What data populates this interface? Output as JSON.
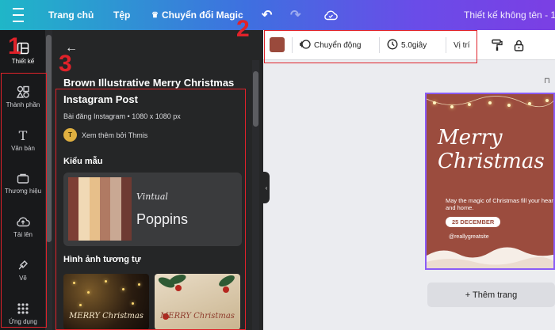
{
  "topbar": {
    "home": "Trang chủ",
    "file": "Tệp",
    "magic": "Chuyển đổi Magic",
    "doc_title": "Thiết kế không tên - 1"
  },
  "rail": [
    {
      "label": "Thiết kế",
      "icon": "layout-icon",
      "active": true
    },
    {
      "label": "Thành phần",
      "icon": "elements-icon"
    },
    {
      "label": "Văn bản",
      "icon": "text-icon"
    },
    {
      "label": "Thương hiệu",
      "icon": "brand-icon"
    },
    {
      "label": "Tải lên",
      "icon": "upload-icon"
    },
    {
      "label": "Vẽ",
      "icon": "draw-icon"
    },
    {
      "label": "Ứng dụng",
      "icon": "apps-icon"
    }
  ],
  "panel": {
    "title": "Brown Illustrative Merry Christmas Instagram Post",
    "meta": "Bài đăng Instagram • 1080 x 1080 px",
    "author_initial": "T",
    "author": "Xem thêm bởi Thmis",
    "style_heading": "Kiểu mẫu",
    "style_font_script": "Vintual",
    "style_font_name": "Poppins",
    "swatch_colors": [
      "#7d3f35",
      "#f0d9b5",
      "#e7bf8a",
      "#b07a63",
      "#c9a893",
      "#6e3a32"
    ],
    "similar_heading": "Hình ảnh tương tự",
    "thumb1_label": "MERRY Christmas",
    "thumb2_label": "MERRY Christmas"
  },
  "toolbar": {
    "fill_color": "#9a4a3c",
    "animate": "Chuyển động",
    "duration": "5.0giây",
    "position": "Vị trí"
  },
  "design": {
    "title_line1": "Merry",
    "title_line2": "Christmas",
    "tagline": "May the magic of Christmas fill your heart and home.",
    "date": "25 DECEMBER",
    "handle": "@reallygreatsite"
  },
  "canvas": {
    "add_page": "+ Thêm trang"
  },
  "annotations": [
    "1",
    "2",
    "3"
  ]
}
